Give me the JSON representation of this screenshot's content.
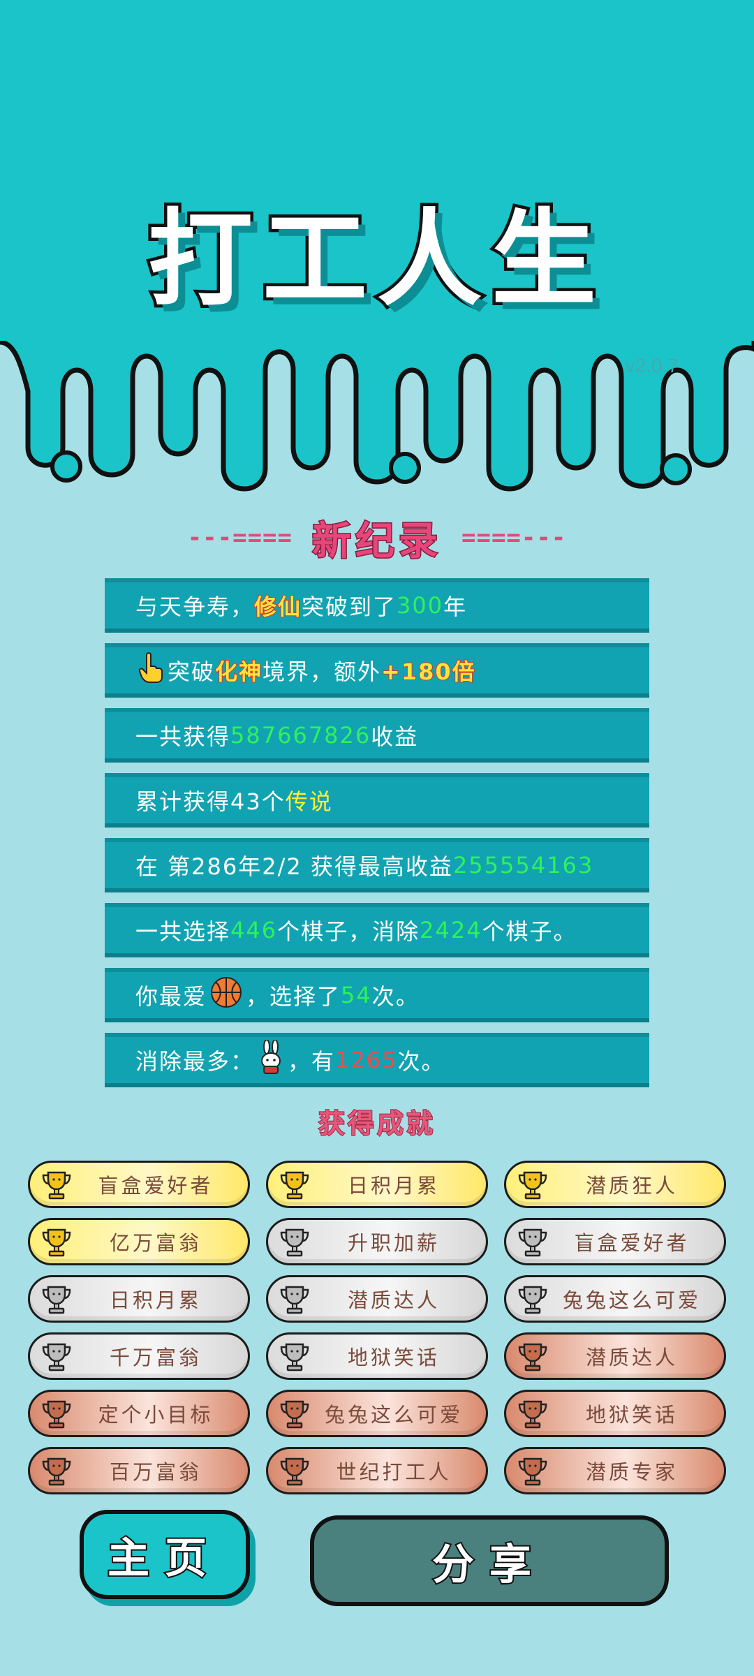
{
  "header": {
    "title": "打工人生",
    "version": "v2.0.7"
  },
  "record": {
    "dash_left": "---====",
    "title": "新纪录",
    "dash_right": "====---"
  },
  "rows": [
    {
      "parts": [
        "与天争寿，",
        "修仙",
        "突破到了",
        "300",
        "年"
      ]
    },
    {
      "parts": [
        "突破",
        "化神",
        "境界，额外",
        "+180倍"
      ]
    },
    {
      "parts": [
        "一共获得",
        "587667826",
        "收益"
      ]
    },
    {
      "parts": [
        "累计获得43个",
        "传说"
      ]
    },
    {
      "parts": [
        "在 第286年2/2 获得最高收益",
        "255554163"
      ]
    },
    {
      "parts": [
        "一共选择",
        "446",
        "个棋子，消除",
        "2424",
        "个棋子。"
      ]
    },
    {
      "parts": [
        "你最爱",
        "，选择了",
        "54",
        "次。"
      ]
    },
    {
      "parts": [
        "消除最多：",
        "，有",
        "1265",
        "次。"
      ]
    }
  ],
  "icons": {
    "hand": "pointing-hand-icon",
    "ball": "basketball-icon",
    "rabbit": "rabbit-icon",
    "trophy": "trophy-icon"
  },
  "achievements": {
    "title": "获得成就",
    "items": [
      {
        "label": "盲盒爱好者",
        "tier": "gold"
      },
      {
        "label": "日积月累",
        "tier": "gold"
      },
      {
        "label": "潜质狂人",
        "tier": "gold"
      },
      {
        "label": "亿万富翁",
        "tier": "gold"
      },
      {
        "label": "升职加薪",
        "tier": "silver"
      },
      {
        "label": "盲盒爱好者",
        "tier": "silver"
      },
      {
        "label": "日积月累",
        "tier": "silver"
      },
      {
        "label": "潜质达人",
        "tier": "silver"
      },
      {
        "label": "兔兔这么可爱",
        "tier": "silver"
      },
      {
        "label": "千万富翁",
        "tier": "silver"
      },
      {
        "label": "地狱笑话",
        "tier": "silver"
      },
      {
        "label": "潜质达人",
        "tier": "bronze"
      },
      {
        "label": "定个小目标",
        "tier": "bronze"
      },
      {
        "label": "兔兔这么可爱",
        "tier": "bronze"
      },
      {
        "label": "地狱笑话",
        "tier": "bronze"
      },
      {
        "label": "百万富翁",
        "tier": "bronze"
      },
      {
        "label": "世纪打工人",
        "tier": "bronze"
      },
      {
        "label": "潜质专家",
        "tier": "bronze"
      }
    ]
  },
  "buttons": {
    "home": "主页",
    "share": "分享"
  },
  "colors": {
    "top_band": "#1ac4c8",
    "page_bg": "#a6e0e6",
    "row_bg": "#12a3b2",
    "highlight_green": "#2ef25a",
    "highlight_yellow": "#ffef3c",
    "highlight_red": "#f04b4b",
    "record_pink": "#e8467a",
    "trophy_gold": "#f2c21b",
    "trophy_silver": "#bdbdbd",
    "trophy_bronze": "#c46d4e"
  }
}
